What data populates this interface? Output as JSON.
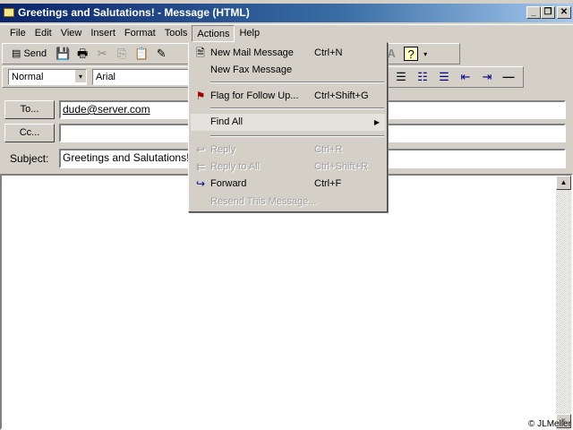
{
  "window": {
    "title": "Greetings and Salutations! - Message (HTML)",
    "minimize": "_",
    "restore": "❐",
    "close": "✕"
  },
  "menubar": [
    "File",
    "Edit",
    "View",
    "Insert",
    "Format",
    "Tools",
    "Actions",
    "Help"
  ],
  "toolbar": {
    "send": "Send",
    "more": "…"
  },
  "format_bar": {
    "style": "Normal",
    "font": "Arial"
  },
  "header": {
    "to_label": "To...",
    "to_value": "dude@server.com",
    "cc_label": "Cc...",
    "cc_value": "",
    "subject_label": "Subject:",
    "subject_value": "Greetings and Salutations!"
  },
  "actions_menu": {
    "items": [
      {
        "label": "New Mail Message",
        "shortcut": "Ctrl+N"
      },
      {
        "label": "New Fax Message",
        "shortcut": ""
      },
      {
        "label": "Flag for Follow Up...",
        "shortcut": "Ctrl+Shift+G"
      },
      {
        "label": "Find All",
        "shortcut": ""
      },
      {
        "label": "Reply",
        "shortcut": "Ctrl+R",
        "disabled": true
      },
      {
        "label": "Reply to All",
        "shortcut": "Ctrl+Shift+R",
        "disabled": true
      },
      {
        "label": "Forward",
        "shortcut": "Ctrl+F"
      },
      {
        "label": "Resend This Message...",
        "shortcut": "",
        "disabled": true
      }
    ]
  },
  "watermark": "© JLMeller",
  "colors": {
    "titlebar": "#0a246a",
    "face": "#d4d0c8"
  }
}
